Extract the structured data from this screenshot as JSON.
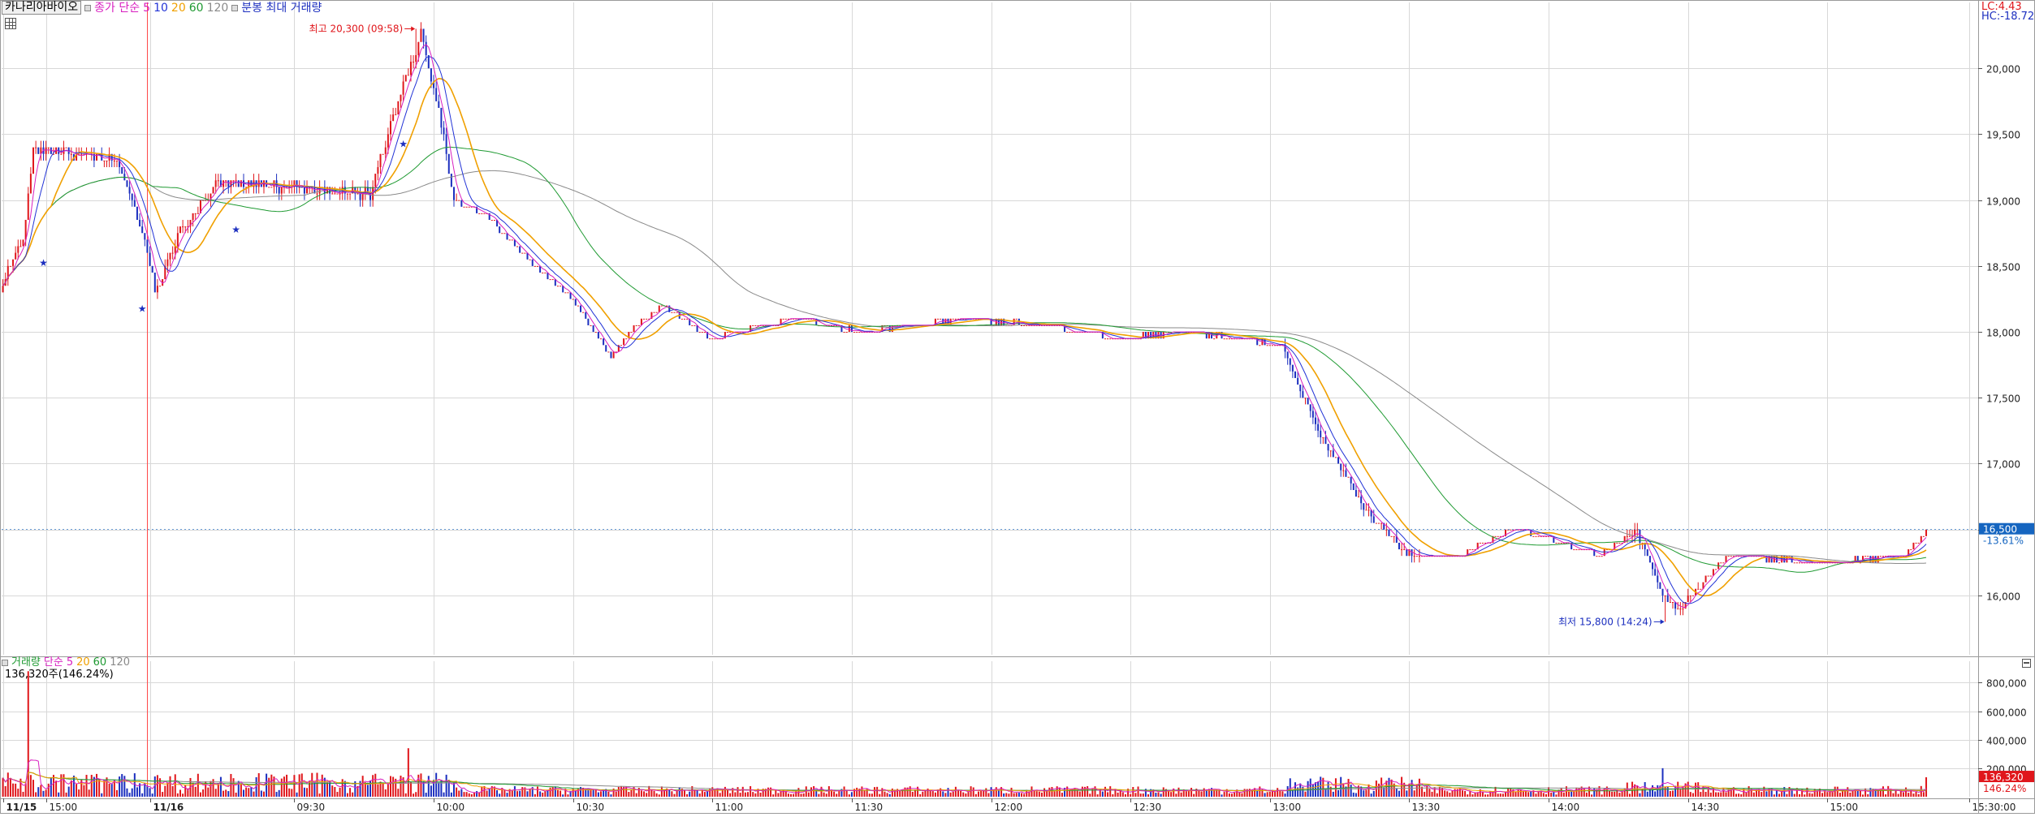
{
  "legend": {
    "symbol": "카나리아바이오",
    "price_ma_label": "종가 단순",
    "periods": [
      "5",
      "10",
      "20",
      "60",
      "120"
    ],
    "minute_label": "분봉 최대 거래량"
  },
  "vol_legend": {
    "label": "거래량",
    "ma_label": "단순",
    "periods": [
      "5",
      "20",
      "60",
      "120"
    ],
    "value_text": "136,320주(146.24%)"
  },
  "corner": {
    "lc": "LC:4.43",
    "hc": "HC:-18.72"
  },
  "colors": {
    "up": "#e0161b",
    "down": "#1c2fbf",
    "ma5": "#d81fc0",
    "ma10": "#2233d6",
    "ma20": "#f0a000",
    "ma60": "#1f9a32",
    "ma120": "#8a8a8a",
    "grid": "#d8d8d8",
    "price_tag": "#1565c0",
    "vol_tag": "#e0161b"
  },
  "chart_data": {
    "type": "candlestick",
    "price_axis": {
      "ylim": [
        15550,
        20500
      ],
      "ticks": [
        "20,000",
        "19,500",
        "19,000",
        "18,500",
        "18,000",
        "17,500",
        "17,000",
        "16,500",
        "16,000"
      ],
      "tick_values": [
        20000,
        19500,
        19000,
        18500,
        18000,
        17500,
        17000,
        16500,
        16000
      ]
    },
    "volume_axis": {
      "ylim": [
        0,
        950000
      ],
      "ticks": [
        "800,000",
        "600,000",
        "400,000",
        "200,000"
      ],
      "tick_values": [
        800000,
        600000,
        400000,
        200000
      ]
    },
    "x_ticks": [
      {
        "i": 0,
        "label": "11/15",
        "bold": true
      },
      {
        "i": 17,
        "label": "15:00"
      },
      {
        "i": 58,
        "label": "11/16",
        "bold": true
      },
      {
        "i": 115,
        "label": "09:30"
      },
      {
        "i": 170,
        "label": "10:00"
      },
      {
        "i": 225,
        "label": "10:30"
      },
      {
        "i": 280,
        "label": "11:00"
      },
      {
        "i": 335,
        "label": "11:30"
      },
      {
        "i": 390,
        "label": "12:00"
      },
      {
        "i": 445,
        "label": "12:30"
      },
      {
        "i": 500,
        "label": "13:00"
      },
      {
        "i": 555,
        "label": "13:30"
      },
      {
        "i": 610,
        "label": "14:00"
      },
      {
        "i": 665,
        "label": "14:30"
      },
      {
        "i": 720,
        "label": "15:00"
      },
      {
        "i": 776,
        "label": "15:30:00"
      }
    ],
    "bar_count": 760,
    "max_annotation": {
      "text": "최고 20,300 (09:58)",
      "i": 163,
      "price": 20300
    },
    "min_annotation": {
      "text": "최저 15,800 (14:24)",
      "i": 656,
      "price": 15800
    },
    "current_price": {
      "price_label": "16,500",
      "pct_label": "-13.61%",
      "price": 16500
    },
    "current_volume": {
      "label": "136,320",
      "pct_label": "146.24%",
      "volume": 136320
    },
    "keypoints": [
      [
        0,
        18400
      ],
      [
        8,
        18700
      ],
      [
        12,
        19400
      ],
      [
        25,
        19350
      ],
      [
        45,
        19300
      ],
      [
        55,
        18800
      ],
      [
        60,
        18300
      ],
      [
        70,
        18750
      ],
      [
        85,
        19150
      ],
      [
        110,
        19100
      ],
      [
        145,
        19050
      ],
      [
        160,
        20000
      ],
      [
        165,
        20250
      ],
      [
        172,
        19700
      ],
      [
        178,
        19000
      ],
      [
        190,
        18900
      ],
      [
        210,
        18500
      ],
      [
        225,
        18250
      ],
      [
        240,
        17800
      ],
      [
        250,
        18050
      ],
      [
        260,
        18200
      ],
      [
        280,
        17950
      ],
      [
        310,
        18100
      ],
      [
        340,
        18000
      ],
      [
        380,
        18100
      ],
      [
        410,
        18050
      ],
      [
        440,
        17950
      ],
      [
        470,
        18000
      ],
      [
        505,
        17900
      ],
      [
        520,
        17200
      ],
      [
        540,
        16600
      ],
      [
        555,
        16300
      ],
      [
        575,
        16300
      ],
      [
        595,
        16500
      ],
      [
        610,
        16450
      ],
      [
        630,
        16300
      ],
      [
        645,
        16500
      ],
      [
        655,
        16000
      ],
      [
        662,
        15900
      ],
      [
        680,
        16300
      ],
      [
        720,
        16250
      ],
      [
        750,
        16300
      ],
      [
        759,
        16480
      ]
    ]
  }
}
